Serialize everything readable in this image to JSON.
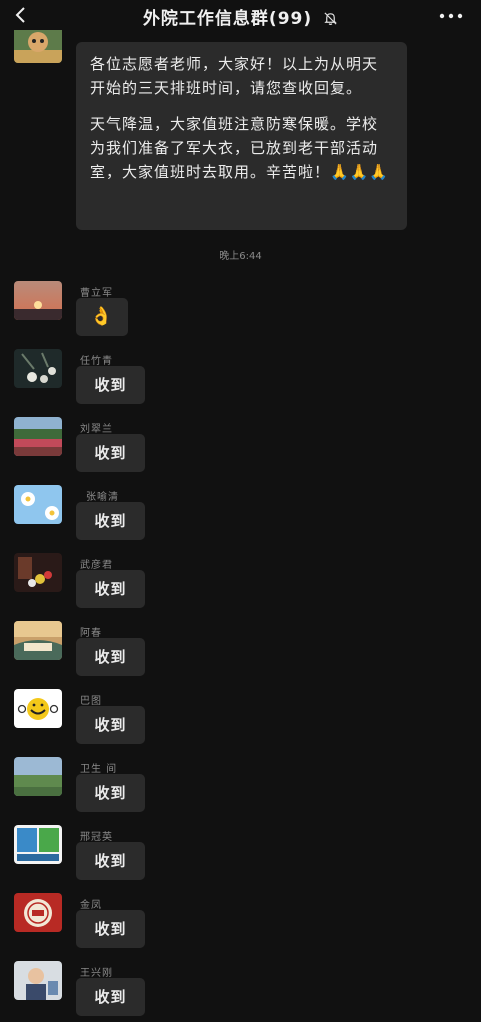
{
  "header": {
    "title": "外院工作信息群(99)",
    "back": "back-icon",
    "mute": "bell-off-icon",
    "more": "more-icon"
  },
  "announcement": {
    "paragraph1": "各位志愿者老师，大家好！以上为从明天开始的三天排班时间，请您查收回复。",
    "paragraph2": "天气降温，大家值班注意防寒保暖。学校为我们准备了军大衣，已放到老干部活动室，大家值班时去取用。辛苦啦！🙏🙏🙏"
  },
  "timestamp": "晚上6:44",
  "messages": [
    {
      "sender": "曹立军",
      "text": "👌"
    },
    {
      "sender": "任竹青",
      "text": "收到"
    },
    {
      "sender": "刘翠兰",
      "text": "收到"
    },
    {
      "sender": "张喻清",
      "text": "收到"
    },
    {
      "sender": "武彦君",
      "text": "收到"
    },
    {
      "sender": "阿春",
      "text": "收到"
    },
    {
      "sender": "巴图",
      "text": "收到"
    },
    {
      "sender": "卫生 间",
      "text": "收到"
    },
    {
      "sender": "邢冠英",
      "text": "收到"
    },
    {
      "sender": "金凤",
      "text": "收到"
    },
    {
      "sender": "王兴刚",
      "text": "收到"
    }
  ],
  "colors": {
    "background": "#111111",
    "bubble": "#2b2b2b",
    "text": "#ececec",
    "meta": "#8a8a8a"
  }
}
